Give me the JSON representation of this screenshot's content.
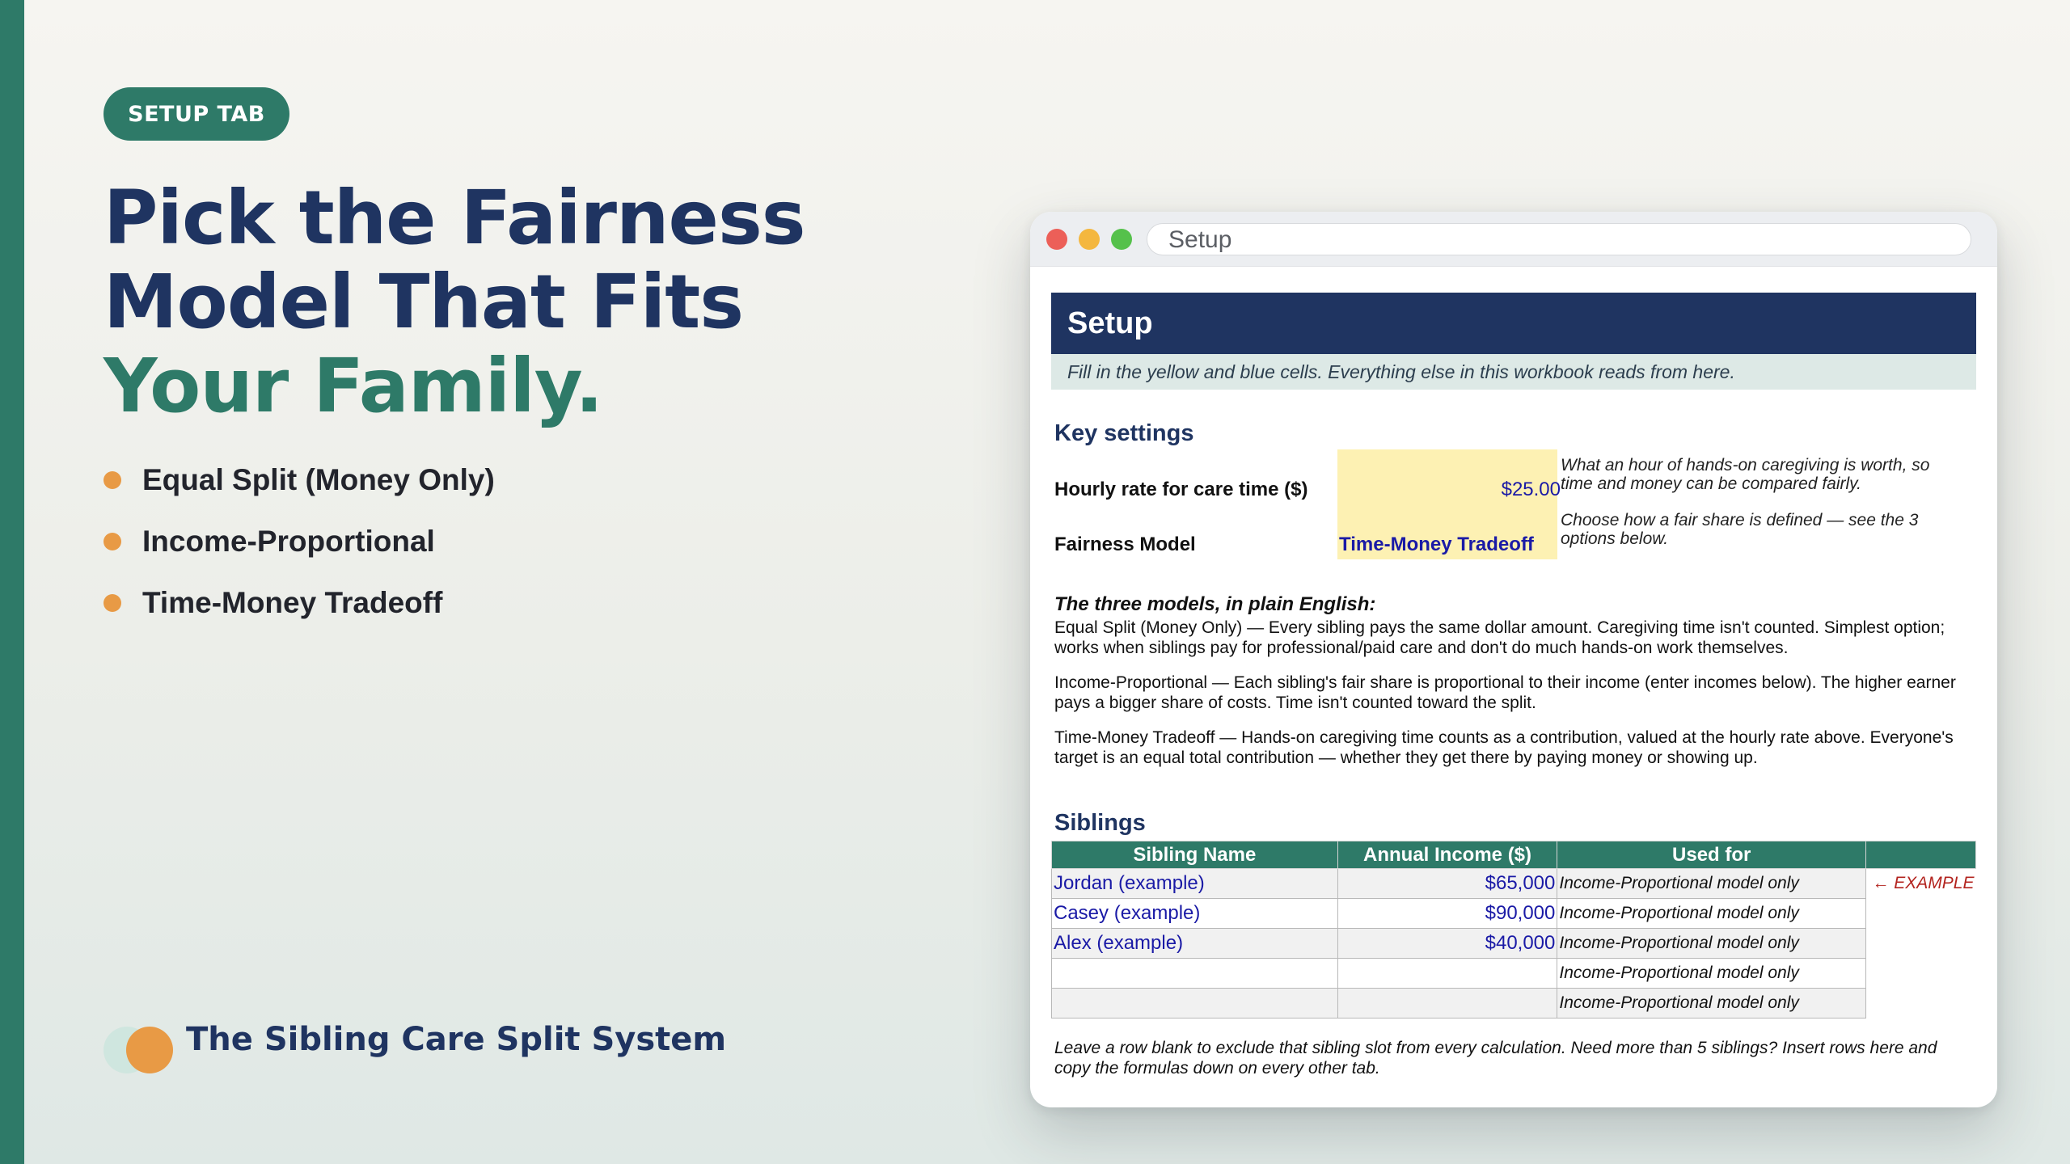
{
  "promo": {
    "badge": "SETUP TAB",
    "headline_line1": "Pick the Fairness",
    "headline_line2": "Model That Fits",
    "headline_accent": "Your Family.",
    "bullets": [
      "Equal Split (Money Only)",
      "Income-Proportional",
      "Time-Money Tradeoff"
    ],
    "brand_name": "The Sibling Care Split System",
    "colors": {
      "navy": "#1f3461",
      "green": "#2e7a68",
      "orange": "#e89a45"
    }
  },
  "window": {
    "address": "Setup",
    "traffic_lights": [
      "close",
      "minimize",
      "maximize"
    ]
  },
  "sheet": {
    "title": "Setup",
    "subtitle": "Fill in the yellow and blue cells. Everything else in this workbook reads from here.",
    "key_settings_heading": "Key settings",
    "hourly_rate_label": "Hourly rate for care time ($)",
    "hourly_rate_value": "$25.00",
    "hourly_rate_note": "What an hour of hands-on caregiving is worth, so time and money can be compared fairly.",
    "model_label": "Fairness Model",
    "model_value": "Time-Money Tradeoff",
    "model_note": "Choose how a fair share is defined — see the 3 options below.",
    "models_heading": "The three models, in plain English:",
    "model_desc_equal": "Equal Split (Money Only) — Every sibling pays the same dollar amount. Caregiving time isn't counted. Simplest option; works when siblings pay for professional/paid care and don't do much hands-on work themselves.",
    "model_desc_income": "Income-Proportional — Each sibling's fair share is proportional to their income (enter incomes below). The higher earner pays a bigger share of costs. Time isn't counted toward the split.",
    "model_desc_tradeoff": "Time-Money Tradeoff — Hands-on caregiving time counts as a contribution, valued at the hourly rate above. Everyone's target is an equal total contribution — whether they get there by paying money or showing up.",
    "siblings_heading": "Siblings",
    "columns": [
      "Sibling Name",
      "Annual Income ($)",
      "Used for"
    ],
    "rows": [
      {
        "name": "Jordan (example)",
        "income": "$65,000",
        "used_for": "Income-Proportional model only",
        "flag": "← EXAMPLE"
      },
      {
        "name": "Casey (example)",
        "income": "$90,000",
        "used_for": "Income-Proportional model only",
        "flag": ""
      },
      {
        "name": "Alex (example)",
        "income": "$40,000",
        "used_for": "Income-Proportional model only",
        "flag": ""
      },
      {
        "name": "",
        "income": "",
        "used_for": "Income-Proportional model only",
        "flag": ""
      },
      {
        "name": "",
        "income": "",
        "used_for": "Income-Proportional model only",
        "flag": ""
      }
    ],
    "footnote": "Leave a row blank to exclude that sibling slot from every calculation. Need more than 5 siblings? Insert rows here and copy the formulas down on every other tab."
  }
}
